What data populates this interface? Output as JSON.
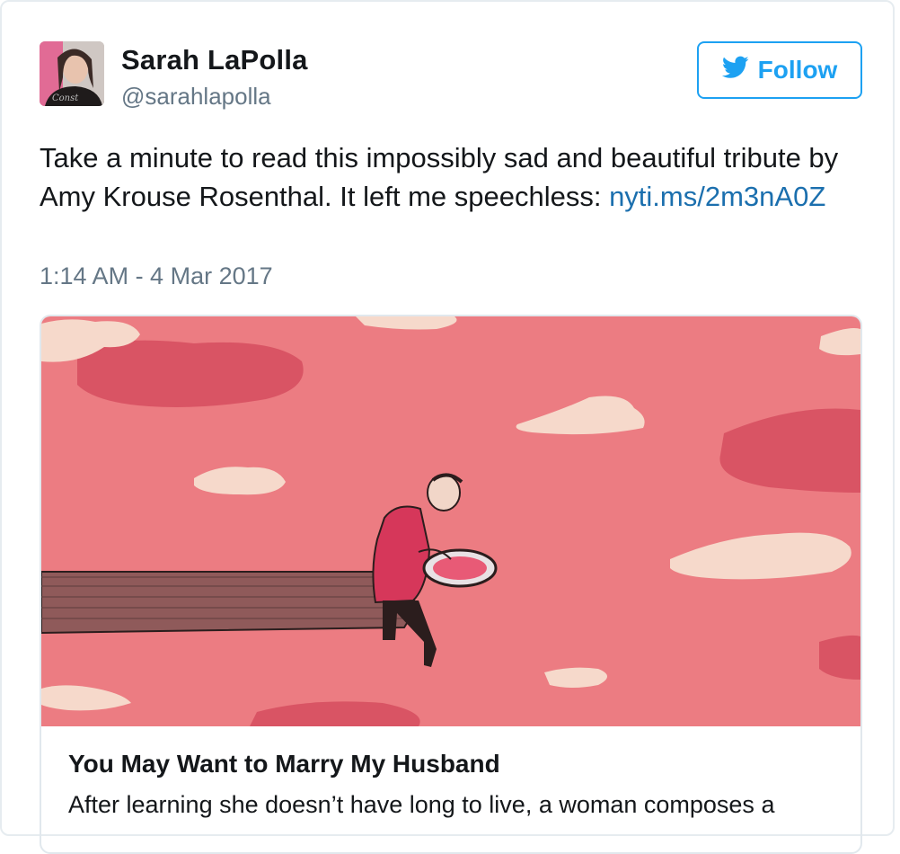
{
  "user": {
    "display_name": "Sarah LaPolla",
    "handle": "@sarahlapolla",
    "avatar": "profile-photo"
  },
  "follow_button": {
    "label": "Follow",
    "icon": "twitter-bird-icon"
  },
  "tweet": {
    "text": "Take a minute to read this impossibly sad and beautiful tribute by Amy Krouse Rosenthal. It left me speechless: ",
    "link": "nyti.ms/2m3nA0Z",
    "timestamp": "1:14 AM - 4 Mar 2017"
  },
  "card": {
    "image": "illustration-man-on-dock-holding-mirror",
    "title": "You May Want to Marry My Husband",
    "description": "After learning she doesn’t have long to live, a woman composes a"
  },
  "colors": {
    "accent": "#1da1f2",
    "link": "#1b6fae",
    "secondary_text": "#657786",
    "card_bg": "#ec7c82"
  }
}
